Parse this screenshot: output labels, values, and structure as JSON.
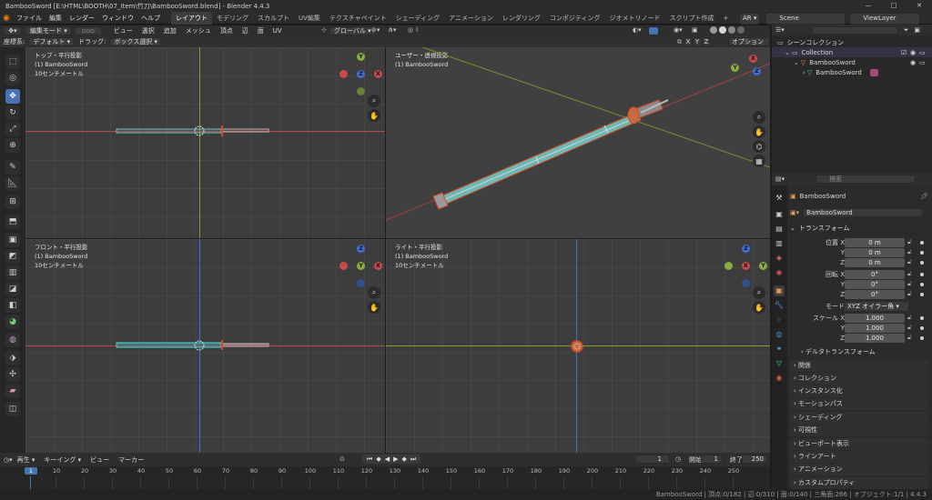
{
  "window": {
    "title": "BambooSword [E:\\HTML\\BOOTH\\07_Item\\竹刀\\BambooSword.blend] - Blender 4.4.3",
    "controls": [
      "—",
      "□",
      "✕"
    ]
  },
  "menu": {
    "items": [
      "ファイル",
      "編集",
      "レンダー",
      "ウィンドウ",
      "ヘルプ"
    ],
    "workspaces": [
      "レイアウト",
      "モデリング",
      "スカルプト",
      "UV編集",
      "テクスチャペイント",
      "シェーディング",
      "アニメーション",
      "レンダリング",
      "コンポジティング",
      "ジオメトリノード",
      "スクリプト作成"
    ],
    "add": "+",
    "scene": "Scene",
    "view_layer": "ViewLayer",
    "ar_label": "AR"
  },
  "viewport_header": {
    "mode": "編集モード",
    "menus": [
      "ビュー",
      "選択",
      "追加",
      "メッシュ",
      "頂点",
      "辺",
      "面",
      "UV"
    ],
    "orientation": "グローバル",
    "axes": [
      "X",
      "Y",
      "Z"
    ],
    "options": "オプション"
  },
  "tool_header": {
    "coord_label": "座標系:",
    "coord_value": "デフォルト",
    "drag_label": "ドラッグ:",
    "drag_value": "ボックス選択"
  },
  "viewports": [
    {
      "id": "top",
      "line1": "トップ・平行投影",
      "line2": "(1) BambooSword",
      "line3": "10センチメートル"
    },
    {
      "id": "user",
      "line1": "ユーザー・透視投影",
      "line2": "(1) BambooSword",
      "line3": ""
    },
    {
      "id": "front",
      "line1": "フロント・平行投影",
      "line2": "(1) BambooSword",
      "line3": "10センチメートル"
    },
    {
      "id": "right",
      "line1": "ライト・平行投影",
      "line2": "(1) BambooSword",
      "line3": "10センチメートル"
    }
  ],
  "outliner": {
    "search_placeholder": "",
    "scene_collection": "シーンコレクション",
    "collection": "Collection",
    "object": "BambooSword",
    "mesh": "BambooSword"
  },
  "properties": {
    "search_placeholder": "検索",
    "object_name": "BambooSword",
    "object_field": "BambooSword",
    "transform_title": "トランスフォーム",
    "location_label": "位置 X",
    "rotation_label": "回転 X",
    "mode_label": "モード",
    "mode_value": "XYZ オイラー角",
    "scale_label": "スケール X",
    "axis_y": "Y",
    "axis_z": "Z",
    "location": [
      "0 m",
      "0 m",
      "0 m"
    ],
    "rotation": [
      "0°",
      "0°",
      "0°"
    ],
    "scale": [
      "1.000",
      "1.000",
      "1.000"
    ],
    "delta": "デルタトランスフォーム",
    "panels": [
      "関係",
      "コレクション",
      "インスタンス化",
      "モーションパス",
      "シェーディング",
      "可視性",
      "ビューポート表示",
      "ラインアート",
      "アニメーション",
      "カスタムプロパティ"
    ]
  },
  "timeline": {
    "menus": [
      "再生",
      "キーイング",
      "ビュー",
      "マーカー"
    ],
    "current_frame": "1",
    "start_label": "開始",
    "start": "1",
    "end_label": "終了",
    "end": "250",
    "ticks": [
      "1",
      "10",
      "20",
      "30",
      "40",
      "50",
      "60",
      "70",
      "80",
      "90",
      "100",
      "110",
      "120",
      "130",
      "140",
      "150",
      "160",
      "170",
      "180",
      "190",
      "200",
      "210",
      "220",
      "230",
      "240",
      "250"
    ]
  },
  "status": {
    "text": "BambooSword | 頂点:0/182 | 辺:0/310 | 面:0/140 | 三角面:266 | オブジェクト:1/1 | 4.4.3"
  },
  "colors": {
    "accent": "#4772b3",
    "x_axis": "#c84a4a",
    "y_axis": "#8aad3a",
    "z_axis": "#3f6fd0",
    "mesh_edge": "#4dd6d6"
  }
}
